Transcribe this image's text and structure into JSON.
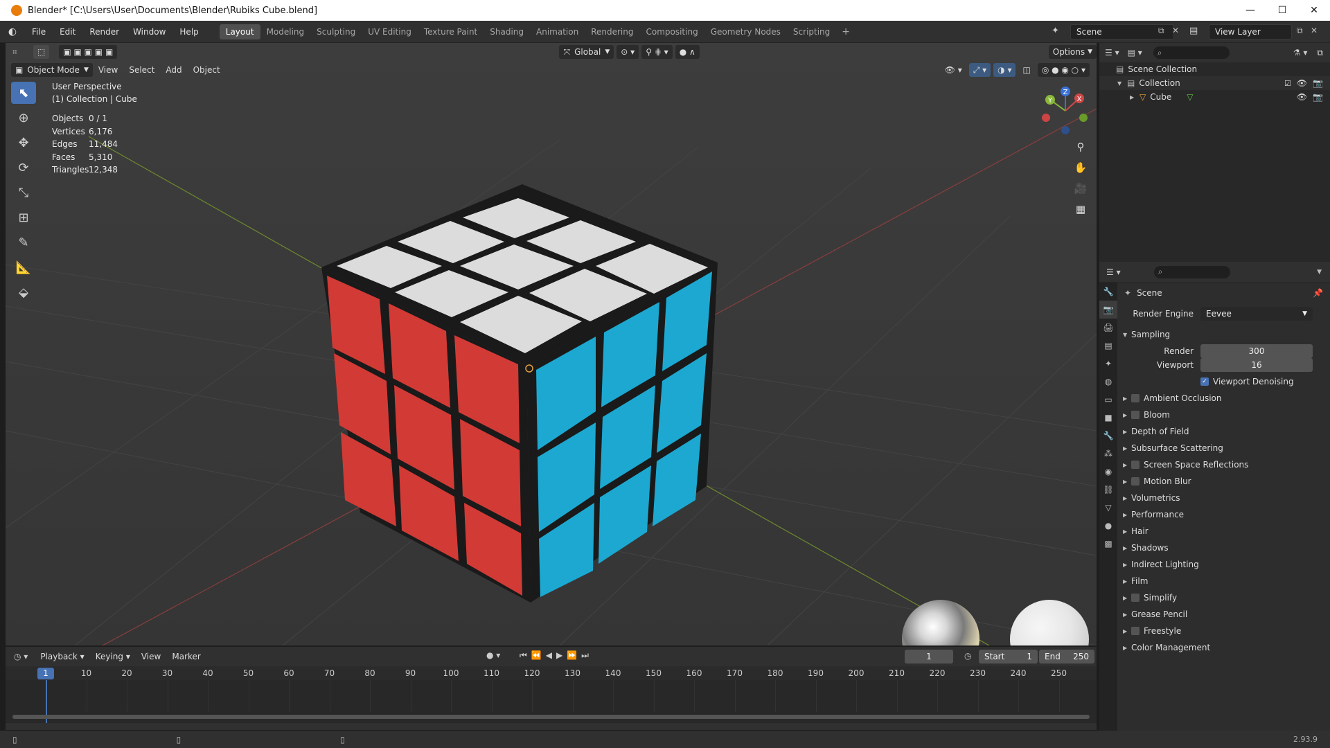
{
  "window": {
    "title": "Blender* [C:\\Users\\User\\Documents\\Blender\\Rubiks Cube.blend]",
    "minimize": "—",
    "maximize": "☐",
    "close": "✕"
  },
  "menus": [
    "File",
    "Edit",
    "Render",
    "Window",
    "Help"
  ],
  "workspaces": [
    {
      "label": "Layout",
      "active": true
    },
    {
      "label": "Modeling"
    },
    {
      "label": "Sculpting"
    },
    {
      "label": "UV Editing"
    },
    {
      "label": "Texture Paint"
    },
    {
      "label": "Shading"
    },
    {
      "label": "Animation"
    },
    {
      "label": "Rendering"
    },
    {
      "label": "Compositing"
    },
    {
      "label": "Geometry Nodes"
    },
    {
      "label": "Scripting"
    }
  ],
  "add_workspace": "+",
  "scene_selector": "Scene",
  "view_layer_selector": "View Layer",
  "viewport": {
    "mode": "Object Mode",
    "menus": [
      "View",
      "Select",
      "Add",
      "Object"
    ],
    "transform_orientation": "Global",
    "options": "Options",
    "perspective_label": "User Perspective",
    "collection_label": "(1) Collection | Cube",
    "stats": [
      {
        "key": "Objects",
        "value": "0 / 1"
      },
      {
        "key": "Vertices",
        "value": "6,176"
      },
      {
        "key": "Edges",
        "value": "11,484"
      },
      {
        "key": "Faces",
        "value": "5,310"
      },
      {
        "key": "Triangles",
        "value": "12,348"
      }
    ],
    "gizmo": {
      "x": "X",
      "y": "Y",
      "z": "Z"
    },
    "colors": {
      "red": "#d23a36",
      "blue": "#1ca8d0",
      "white": "#d9d9d9",
      "background": "#393939"
    }
  },
  "outliner": {
    "items": [
      {
        "label": "Scene Collection"
      },
      {
        "label": "Collection"
      },
      {
        "label": "Cube"
      }
    ]
  },
  "properties": {
    "scene_label": "Scene",
    "render_engine_label": "Render Engine",
    "render_engine_value": "Eevee",
    "sampling_label": "Sampling",
    "render_label": "Render",
    "render_value": "300",
    "viewport_label": "Viewport",
    "viewport_value": "16",
    "denoise_label": "Viewport Denoising",
    "denoise_checked": true,
    "panels": [
      {
        "label": "Ambient Occlusion",
        "checkbox": true
      },
      {
        "label": "Bloom",
        "checkbox": true
      },
      {
        "label": "Depth of Field",
        "checkbox": false
      },
      {
        "label": "Subsurface Scattering",
        "checkbox": false
      },
      {
        "label": "Screen Space Reflections",
        "checkbox": true
      },
      {
        "label": "Motion Blur",
        "checkbox": true
      },
      {
        "label": "Volumetrics",
        "checkbox": false
      },
      {
        "label": "Performance",
        "checkbox": false
      },
      {
        "label": "Hair",
        "checkbox": false
      },
      {
        "label": "Shadows",
        "checkbox": false
      },
      {
        "label": "Indirect Lighting",
        "checkbox": false
      },
      {
        "label": "Film",
        "checkbox": false
      },
      {
        "label": "Simplify",
        "checkbox": true
      },
      {
        "label": "Grease Pencil",
        "checkbox": false
      },
      {
        "label": "Freestyle",
        "checkbox": true
      },
      {
        "label": "Color Management",
        "checkbox": false
      }
    ]
  },
  "timeline": {
    "menus": [
      "Playback",
      "Keying",
      "View",
      "Marker"
    ],
    "current_frame": "1",
    "start_label": "Start",
    "start_value": "1",
    "end_label": "End",
    "end_value": "250",
    "ticks": [
      "10",
      "20",
      "30",
      "40",
      "50",
      "60",
      "70",
      "80",
      "90",
      "100",
      "110",
      "120",
      "130",
      "140",
      "150",
      "160",
      "170",
      "180",
      "190",
      "200",
      "210",
      "220",
      "230",
      "240",
      "250"
    ]
  },
  "version": "2.93.9"
}
